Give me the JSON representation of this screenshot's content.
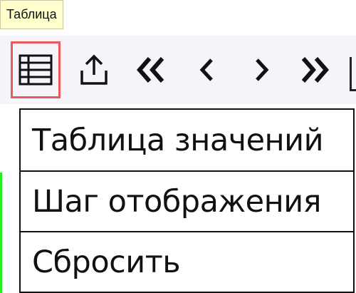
{
  "tooltip": {
    "text": "Таблица"
  },
  "toolbar": {
    "buttons": [
      {
        "icon": "table-icon",
        "active": true
      },
      {
        "icon": "share-icon"
      },
      {
        "icon": "first-page-icon"
      },
      {
        "icon": "prev-icon"
      },
      {
        "icon": "next-icon"
      },
      {
        "icon": "last-page-icon"
      }
    ]
  },
  "menu": {
    "items": [
      {
        "label": "Таблица значений"
      },
      {
        "label": "Шаг отображения"
      },
      {
        "label": "Сбросить"
      }
    ]
  },
  "colors": {
    "tooltip_bg": "#ffffcc",
    "toolbar_bg": "#f6f4fa",
    "active_outline": "#e85a5a",
    "accent_line": "#22ee22"
  }
}
